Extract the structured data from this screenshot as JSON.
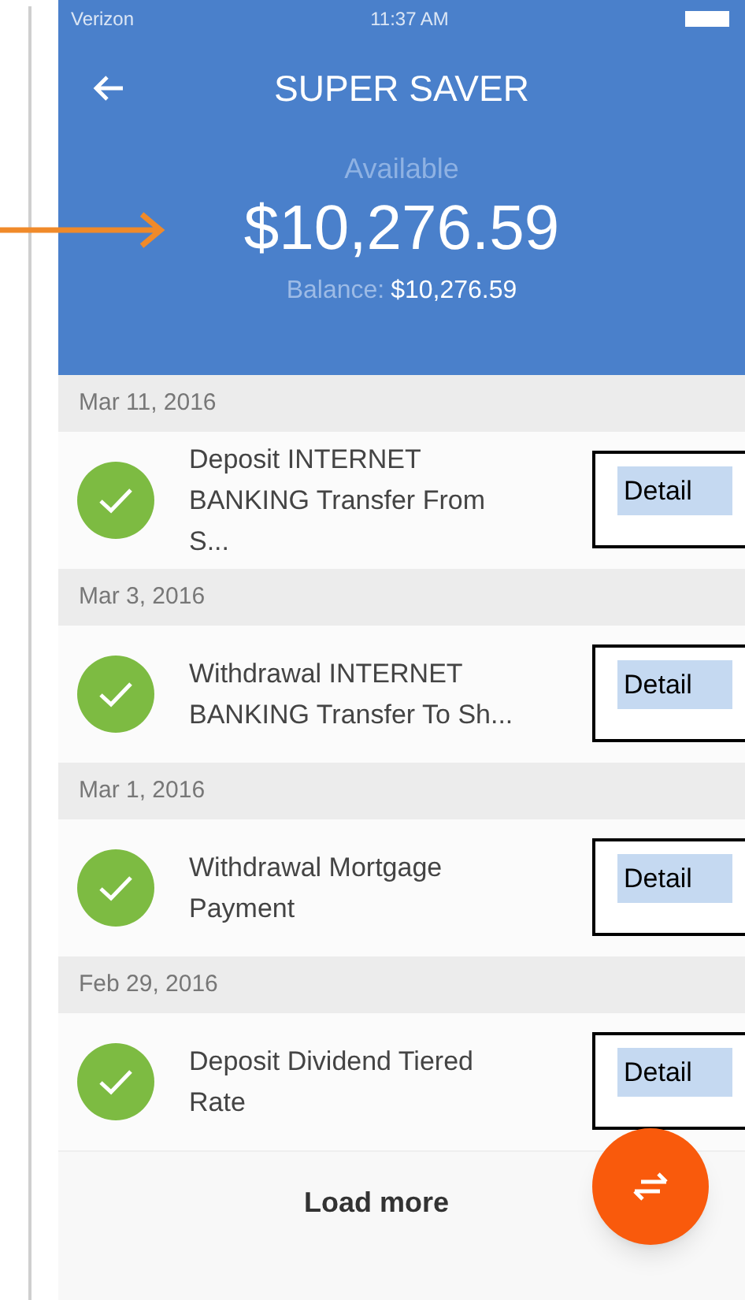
{
  "status_bar": {
    "carrier": "Verizon",
    "time": "11:37 AM"
  },
  "header": {
    "title": "SUPER SAVER",
    "available_label": "Available",
    "available_amount": "$10,276.59",
    "balance_label": "Balance:",
    "balance_amount": "$10,276.59"
  },
  "groups": [
    {
      "date": "Mar 11, 2016",
      "description": "Deposit INTERNET BANKING Transfer From S...",
      "annotation": "Detail"
    },
    {
      "date": "Mar 3, 2016",
      "description": "Withdrawal INTERNET BANKING Transfer To Sh...",
      "annotation": "Detail"
    },
    {
      "date": "Mar 1, 2016",
      "description": "Withdrawal Mortgage Payment",
      "annotation": "Detail"
    },
    {
      "date": "Feb 29, 2016",
      "description": "Deposit Dividend Tiered Rate",
      "annotation": "Detail"
    }
  ],
  "load_more": "Load more"
}
